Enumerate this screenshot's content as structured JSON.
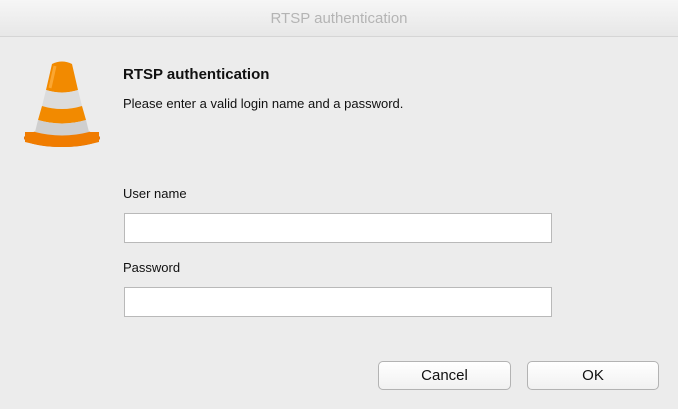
{
  "window": {
    "title": "RTSP authentication"
  },
  "dialog": {
    "icon": "vlc-cone-icon",
    "heading": "RTSP authentication",
    "message": "Please enter a valid login name and a password.",
    "username": {
      "label": "User name",
      "value": "",
      "placeholder": ""
    },
    "password": {
      "label": "Password",
      "value": "",
      "placeholder": ""
    },
    "buttons": {
      "cancel": "Cancel",
      "ok": "OK"
    }
  },
  "colors": {
    "background": "#ececec",
    "cone_orange": "#f07c00",
    "cone_stripe": "#d9d9d9",
    "titlebar_text": "#b4b4b4"
  }
}
